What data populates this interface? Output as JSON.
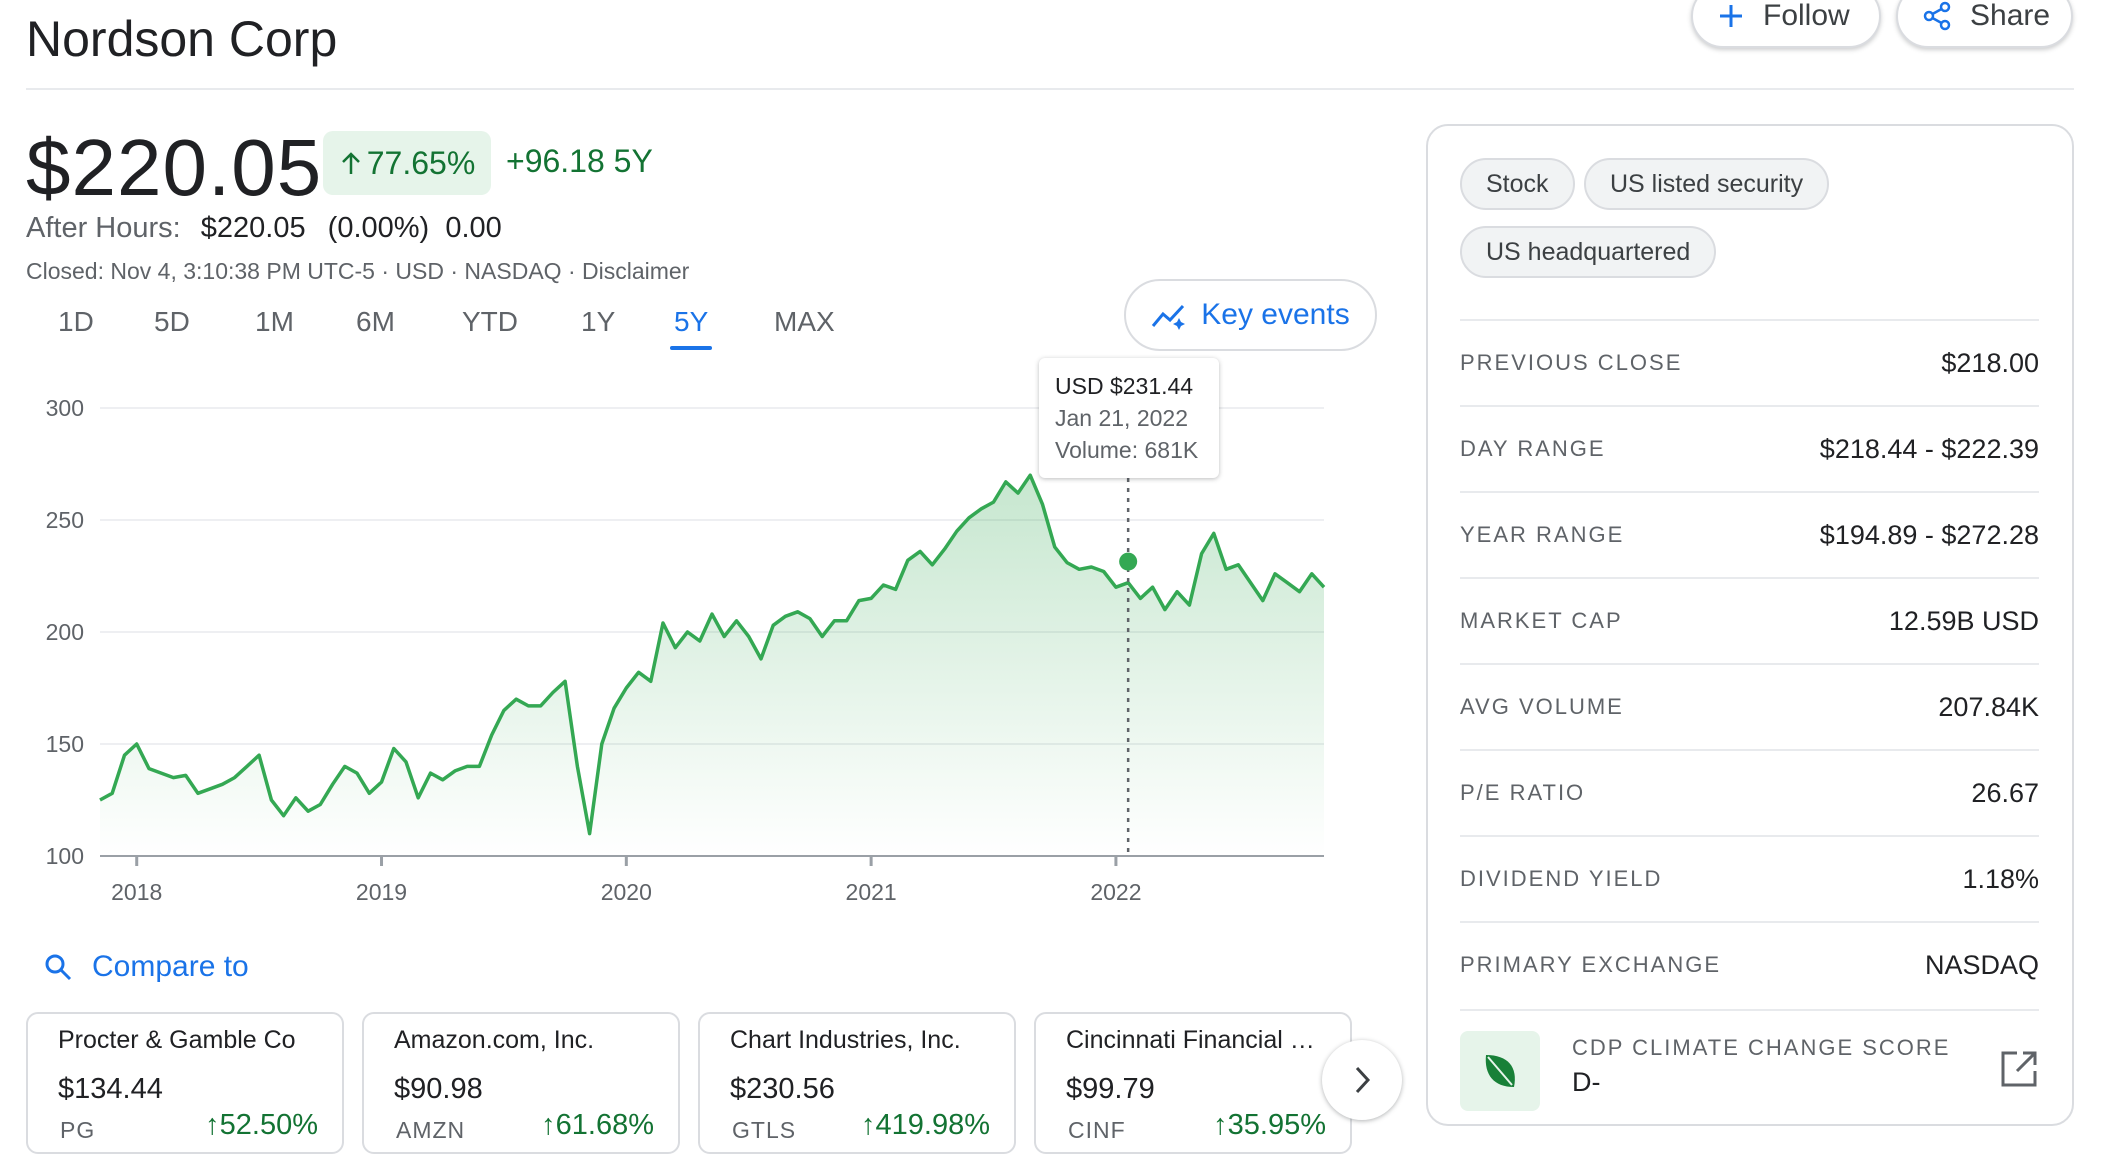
{
  "header": {
    "title": "Nordson Corp",
    "follow_label": "Follow",
    "share_label": "Share"
  },
  "quote": {
    "price": "$220.05",
    "change_pct": "77.65%",
    "change_abs": "+96.18 5Y",
    "after_hours_label": "After Hours:",
    "after_hours_value": "$220.05",
    "after_hours_change": "(0.00%)  0.00",
    "closed_line": "Closed: Nov 4, 3:10:38 PM UTC-5 · USD · NASDAQ · Disclaimer"
  },
  "ranges": {
    "tabs": [
      "1D",
      "5D",
      "1M",
      "6M",
      "YTD",
      "1Y",
      "5Y",
      "MAX"
    ],
    "selected": "5Y"
  },
  "key_events_label": "Key events",
  "colors": {
    "accent": "#1a73e8",
    "positive": "#137333",
    "line": "#34a853"
  },
  "tooltip": {
    "price": "USD $231.44",
    "date": "Jan 21, 2022",
    "volume": "Volume: 681K"
  },
  "chart_data": {
    "type": "area",
    "title": "",
    "xlabel": "",
    "ylabel": "",
    "ylim": [
      100,
      300
    ],
    "yticks": [
      "300",
      "250",
      "200",
      "150",
      "100"
    ],
    "xticks": [
      "2018",
      "2019",
      "2020",
      "2021",
      "2022"
    ],
    "xlim": [
      2017.85,
      2022.85
    ],
    "grid": true,
    "series": [
      {
        "x": [
          2017.85,
          2017.9,
          2017.95,
          2018.0,
          2018.05,
          2018.1,
          2018.15,
          2018.2,
          2018.25,
          2018.3,
          2018.35,
          2018.4,
          2018.45,
          2018.5,
          2018.55,
          2018.6,
          2018.65,
          2018.7,
          2018.75,
          2018.8,
          2018.85,
          2018.9,
          2018.95,
          2019.0,
          2019.05,
          2019.1,
          2019.15,
          2019.2,
          2019.25,
          2019.3,
          2019.35,
          2019.4,
          2019.45,
          2019.5,
          2019.55,
          2019.6,
          2019.65,
          2019.7,
          2019.75,
          2019.8,
          2019.85,
          2019.9,
          2019.95,
          2020.0,
          2020.05,
          2020.1,
          2020.15,
          2020.2,
          2020.25,
          2020.3,
          2020.35,
          2020.4,
          2020.45,
          2020.5,
          2020.55,
          2020.6,
          2020.65,
          2020.7,
          2020.75,
          2020.8,
          2020.85,
          2020.9,
          2020.95,
          2021.0,
          2021.05,
          2021.1,
          2021.15,
          2021.2,
          2021.25,
          2021.3,
          2021.35,
          2021.4,
          2021.45,
          2021.5,
          2021.55,
          2021.6,
          2021.65,
          2021.7,
          2021.75,
          2021.8,
          2021.85,
          2021.9,
          2021.95,
          2022.0,
          2022.05,
          2022.1,
          2022.15,
          2022.2,
          2022.25,
          2022.3,
          2022.35,
          2022.4,
          2022.45,
          2022.5,
          2022.55,
          2022.6,
          2022.65,
          2022.7,
          2022.75,
          2022.8,
          2022.85
        ],
        "values": [
          125,
          128,
          145,
          150,
          139,
          137,
          135,
          136,
          128,
          130,
          132,
          135,
          140,
          145,
          125,
          118,
          126,
          120,
          123,
          132,
          140,
          137,
          128,
          133,
          148,
          142,
          126,
          137,
          134,
          138,
          140,
          140,
          154,
          165,
          170,
          167,
          167,
          173,
          178,
          140,
          110,
          150,
          166,
          175,
          182,
          178,
          204,
          193,
          200,
          196,
          208,
          198,
          205,
          198,
          188,
          203,
          207,
          209,
          206,
          198,
          205,
          205,
          214,
          215,
          221,
          219,
          232,
          236,
          230,
          237,
          245,
          251,
          255,
          258,
          267,
          262,
          270,
          257,
          238,
          231,
          228,
          229,
          227,
          220,
          222,
          215,
          220,
          210,
          218,
          212,
          235,
          244,
          228,
          230,
          222,
          214,
          226,
          222,
          218,
          226,
          220
        ]
      }
    ],
    "highlight": {
      "x": 2022.05,
      "y": 231.44
    }
  },
  "compare": {
    "label": "Compare to",
    "cards": [
      {
        "name": "Procter & Gamble Co",
        "price": "$134.44",
        "ticker": "PG",
        "change": "52.50%"
      },
      {
        "name": "Amazon.com, Inc.",
        "price": "$90.98",
        "ticker": "AMZN",
        "change": "61.68%"
      },
      {
        "name": "Chart Industries, Inc.",
        "price": "$230.56",
        "ticker": "GTLS",
        "change": "419.98%"
      },
      {
        "name": "Cincinnati Financial Co...",
        "price": "$99.79",
        "ticker": "CINF",
        "change": "35.95%"
      }
    ]
  },
  "panel": {
    "chips": [
      "Stock",
      "US listed security",
      "US headquartered"
    ],
    "stats": [
      {
        "label": "PREVIOUS CLOSE",
        "value": "$218.00"
      },
      {
        "label": "DAY RANGE",
        "value": "$218.44 - $222.39"
      },
      {
        "label": "YEAR RANGE",
        "value": "$194.89 - $272.28"
      },
      {
        "label": "MARKET CAP",
        "value": "12.59B USD"
      },
      {
        "label": "AVG VOLUME",
        "value": "207.84K"
      },
      {
        "label": "P/E RATIO",
        "value": "26.67"
      },
      {
        "label": "DIVIDEND YIELD",
        "value": "1.18%"
      },
      {
        "label": "PRIMARY EXCHANGE",
        "value": "NASDAQ"
      }
    ],
    "cdp_label": "CDP CLIMATE CHANGE SCORE",
    "cdp_value": "D-"
  }
}
